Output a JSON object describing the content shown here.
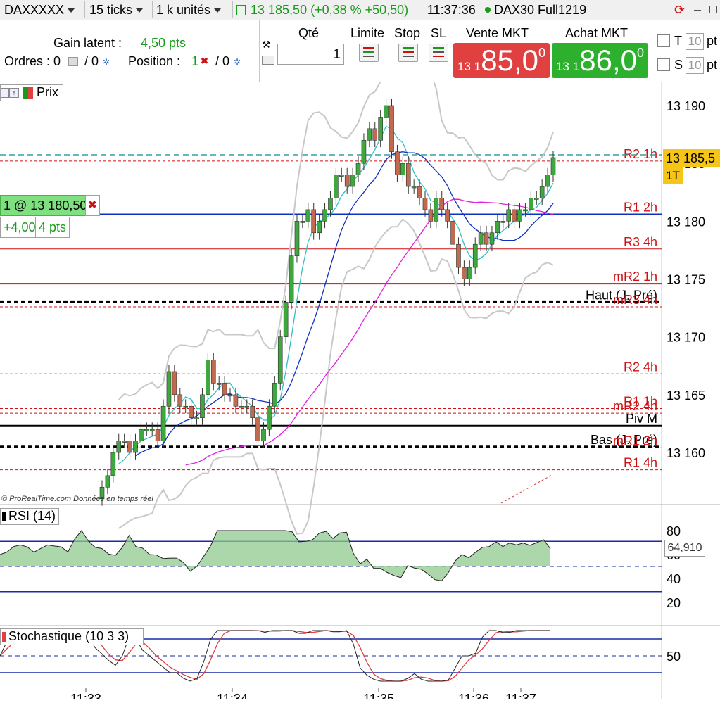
{
  "topbar": {
    "symbol": "DAXXXXX",
    "timeframe": "15 ticks",
    "units": "1 k unités",
    "price_info": "13 185,50 (+0,38 % +50,50)",
    "time": "11:37:36",
    "feed_dot_color": "#1a9a1a",
    "instrument": "DAX30 Full1219"
  },
  "order": {
    "gain_label": "Gain latent :",
    "gain_value": "4,50 pts",
    "orders_label": "Ordres : 0",
    "orders_sep": "/ 0",
    "position_label": "Position :",
    "position_value": "1",
    "position_sep": "/ 0",
    "qty_label": "Qté",
    "qty_value": "1",
    "limit_label": "Limite",
    "stop_label": "Stop",
    "sl_label": "SL",
    "sell_label": "Vente MKT",
    "buy_label": "Achat MKT",
    "sell_prefix": "13 1",
    "sell_big": "85,0",
    "sell_sup": "0",
    "buy_prefix": "13 1",
    "buy_big": "86,0",
    "buy_sup": "0",
    "t_label": "T",
    "s_label": "S",
    "t_value": "10",
    "s_value": "10",
    "t_unit": "pt",
    "s_unit": "pt",
    "sell_color": "#e04040",
    "buy_color": "#2db02d"
  },
  "price_panel": {
    "title": "Prix",
    "position_label": "1 @ 13 180,50",
    "position_pl": "+4,00",
    "position_pts": "4 pts",
    "last_price_tag": "13 185,5",
    "last_tag_sub": "1T",
    "watermark": "© ProRealTime.com  Données en temps réel",
    "y_ticks": [
      "13 190",
      "13 185",
      "13 180",
      "13 175",
      "13 170",
      "13 165",
      "13 160"
    ],
    "y_tick_values": [
      13190,
      13185,
      13180,
      13175,
      13170,
      13165,
      13160
    ],
    "levels": [
      {
        "label": "R2 1h",
        "value": 13185.2,
        "color": "#d01010",
        "style": "dotted"
      },
      {
        "label": "R1 2h",
        "value": 13180.6,
        "color": "#d01010",
        "style": "solid-blue"
      },
      {
        "label": "R3 4h",
        "value": 13177.6,
        "color": "#d01010",
        "style": "thin"
      },
      {
        "label": "mR2 1h",
        "value": 13174.6,
        "color": "#d01010",
        "style": "thick"
      },
      {
        "label": "Haut (J. Pré)",
        "value": 13173.0,
        "color": "#000000",
        "style": "dash-black"
      },
      {
        "label": "mR3 4h",
        "value": 13172.6,
        "color": "#d01010",
        "style": "dotted"
      },
      {
        "label": "R2 4h",
        "value": 13166.8,
        "color": "#d01010",
        "style": "dotted"
      },
      {
        "label": "R1 1h",
        "value": 13163.8,
        "color": "#d01010",
        "style": "dotted"
      },
      {
        "label": "mR2 4h",
        "value": 13163.4,
        "color": "#d01010",
        "style": "dotted"
      },
      {
        "label": "Piv M",
        "value": 13162.3,
        "color": "#000000",
        "style": "solid-black"
      },
      {
        "label": "Bas (J. Pré)",
        "value": 13160.5,
        "color": "#000000",
        "style": "dash-black"
      },
      {
        "label": "mR1 2h",
        "value": 13160.4,
        "color": "#d01010",
        "style": "dotted"
      },
      {
        "label": "R1 4h",
        "value": 13158.5,
        "color": "#d01010",
        "style": "dotted"
      }
    ]
  },
  "rsi": {
    "title": "RSI (14)",
    "current_value": "64,910",
    "ticks": [
      "80",
      "60",
      "40",
      "20"
    ],
    "tick_values": [
      80,
      60,
      40,
      20
    ]
  },
  "stoch": {
    "title": "Stochastique (10 3 3)",
    "ticks": [
      "50"
    ],
    "tick_values": [
      50
    ]
  },
  "time_axis": [
    "11:33",
    "11:34",
    "11:35",
    "11:36",
    "11:37"
  ],
  "chart_data": {
    "type": "candlestick",
    "y_range": [
      13155,
      13192
    ],
    "closes": [
      13157,
      13158,
      13160,
      13161,
      13161,
      13160,
      13161,
      13162,
      13162,
      13162,
      13161,
      13164,
      13167,
      13165,
      13164,
      13164,
      13163,
      13163,
      13165,
      13168,
      13166,
      13166,
      13165,
      13165,
      13164,
      13164,
      13164,
      13163,
      13161,
      13162,
      13164,
      13166,
      13170,
      13173,
      13177,
      13180,
      13180,
      13181,
      13179,
      13180,
      13181,
      13182,
      13184,
      13184,
      13183,
      13184,
      13185,
      13187,
      13188,
      13187,
      13189,
      13190,
      13186,
      13184,
      13185,
      13183,
      13183,
      13182,
      13181,
      13180,
      13182,
      13181,
      13180,
      13178,
      13176,
      13175,
      13176,
      13178,
      13179,
      13178,
      13179,
      13180,
      13180,
      13181,
      13180,
      13181,
      13181,
      13182,
      13182,
      13183,
      13184,
      13185.5
    ],
    "rsi_level": 64.91
  }
}
